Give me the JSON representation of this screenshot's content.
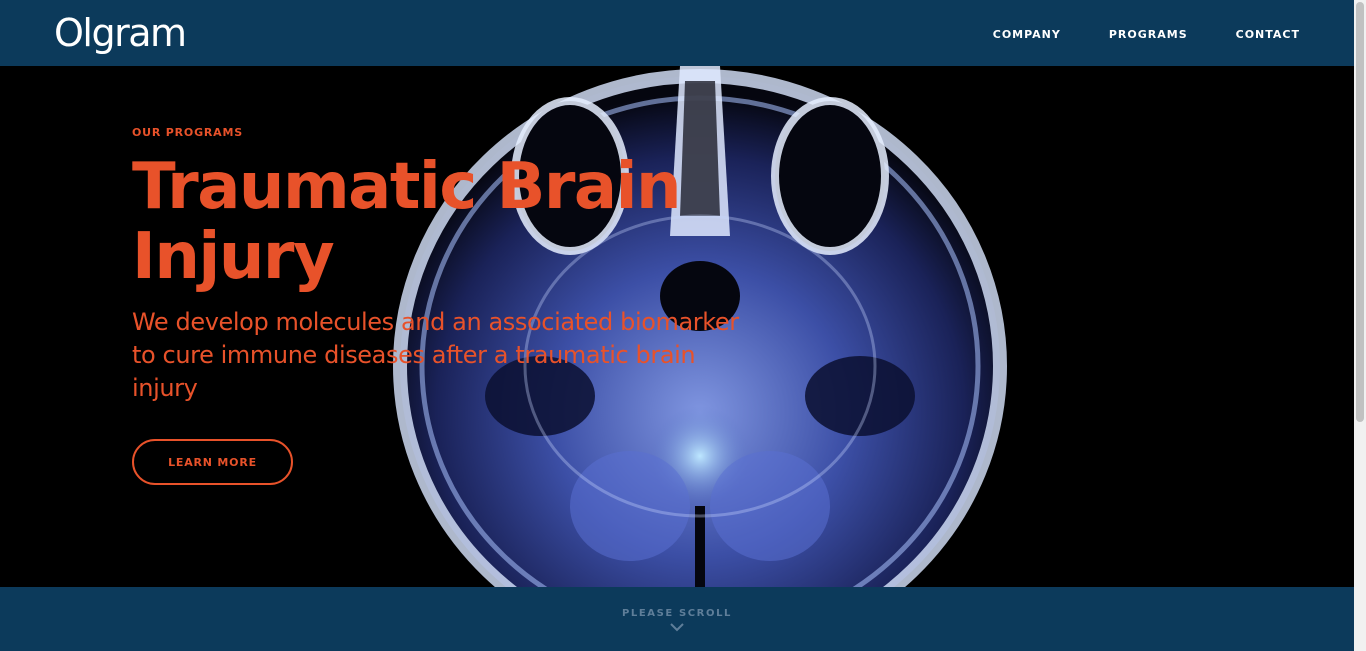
{
  "header": {
    "logo": "Olgram",
    "nav": [
      {
        "label": "COMPANY"
      },
      {
        "label": "PROGRAMS"
      },
      {
        "label": "CONTACT"
      }
    ]
  },
  "hero": {
    "eyebrow": "OUR PROGRAMS",
    "title": "Traumatic Brain Injury",
    "subtitle": "We develop molecules and an associated biomarker to cure immune diseases after a traumatic brain injury",
    "cta_label": "LEARN MORE",
    "image_icon": "brain-mri-scan"
  },
  "footer": {
    "scroll_label": "PLEASE SCROLL",
    "chevron_icon": "chevron-down-icon"
  },
  "colors": {
    "navy": "#0c3a5b",
    "accent": "#e8522a",
    "hero_bg": "#000000",
    "scroll_text": "#5f7e99"
  }
}
